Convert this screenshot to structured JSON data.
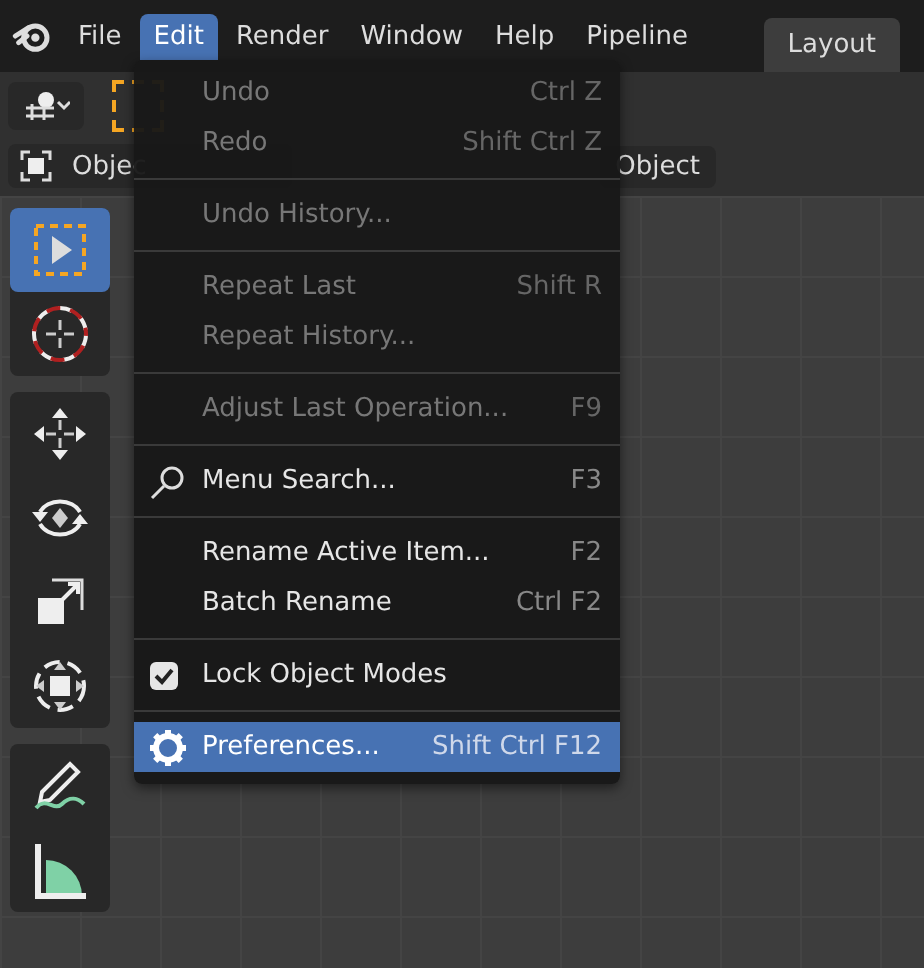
{
  "menubar": {
    "items": [
      {
        "label": "File",
        "selected": false
      },
      {
        "label": "Edit",
        "selected": true
      },
      {
        "label": "Render",
        "selected": false
      },
      {
        "label": "Window",
        "selected": false
      },
      {
        "label": "Help",
        "selected": false
      },
      {
        "label": "Pipeline",
        "selected": false
      }
    ]
  },
  "workspace_tabs": [
    {
      "label": "Layout",
      "selected": true
    }
  ],
  "header": {
    "mode_label": "Objec",
    "object_menu": "Object"
  },
  "edit_menu": [
    {
      "kind": "item",
      "label": "Undo",
      "shortcut": "Ctrl Z",
      "disabled": true,
      "selected": false
    },
    {
      "kind": "item",
      "label": "Redo",
      "shortcut": "Shift Ctrl Z",
      "disabled": true,
      "selected": false
    },
    {
      "kind": "separator"
    },
    {
      "kind": "item",
      "label": "Undo History...",
      "disabled": true,
      "selected": false
    },
    {
      "kind": "separator"
    },
    {
      "kind": "item",
      "label": "Repeat Last",
      "shortcut": "Shift R",
      "disabled": true,
      "selected": false
    },
    {
      "kind": "item",
      "label": "Repeat History...",
      "disabled": true,
      "selected": false
    },
    {
      "kind": "separator"
    },
    {
      "kind": "item",
      "label": "Adjust Last Operation...",
      "shortcut": "F9",
      "disabled": true,
      "selected": false
    },
    {
      "kind": "separator"
    },
    {
      "kind": "search",
      "label": "Menu Search...",
      "shortcut": "F3",
      "disabled": false,
      "selected": false
    },
    {
      "kind": "separator"
    },
    {
      "kind": "item",
      "label": "Rename Active Item...",
      "shortcut": "F2",
      "disabled": false,
      "selected": false
    },
    {
      "kind": "item",
      "label": "Batch Rename",
      "shortcut": "Ctrl F2",
      "disabled": false,
      "selected": false
    },
    {
      "kind": "separator"
    },
    {
      "kind": "check",
      "label": "Lock Object Modes",
      "checked": true,
      "disabled": false,
      "selected": false
    },
    {
      "kind": "separator"
    },
    {
      "kind": "prefs",
      "label": "Preferences...",
      "shortcut": "Shift Ctrl F12",
      "disabled": false,
      "selected": true
    }
  ],
  "toolbar": [
    [
      {
        "kind": "select",
        "selected": true
      },
      {
        "kind": "cursor",
        "selected": false
      }
    ],
    [
      {
        "kind": "move",
        "selected": false
      },
      {
        "kind": "rotate",
        "selected": false
      },
      {
        "kind": "scale",
        "selected": false
      },
      {
        "kind": "transform",
        "selected": false
      }
    ],
    [
      {
        "kind": "annotate",
        "selected": false
      },
      {
        "kind": "measure",
        "selected": false
      }
    ]
  ]
}
